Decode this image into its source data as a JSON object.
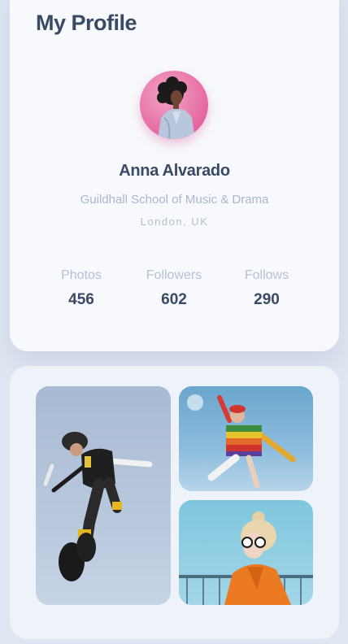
{
  "header": {
    "title": "My Profile"
  },
  "profile": {
    "avatar_icon": "woman-portrait",
    "name": "Anna Alvarado",
    "school": "Guildhall School of Music & Drama",
    "location": "London, UK"
  },
  "stats": [
    {
      "label": "Photos",
      "value": "456"
    },
    {
      "label": "Followers",
      "value": "602"
    },
    {
      "label": "Follows",
      "value": "290"
    }
  ],
  "gallery": {
    "photos": [
      {
        "subject": "jumping-man-photo"
      },
      {
        "subject": "rainbow-sweater-photo"
      },
      {
        "subject": "orange-jacket-photo"
      }
    ]
  },
  "colors": {
    "background": "#dfe6f1",
    "card": "#f7f9fd",
    "title_text": "#3b4a64",
    "muted_text": "#aab6cb",
    "avatar_ring": "#e5679f"
  }
}
